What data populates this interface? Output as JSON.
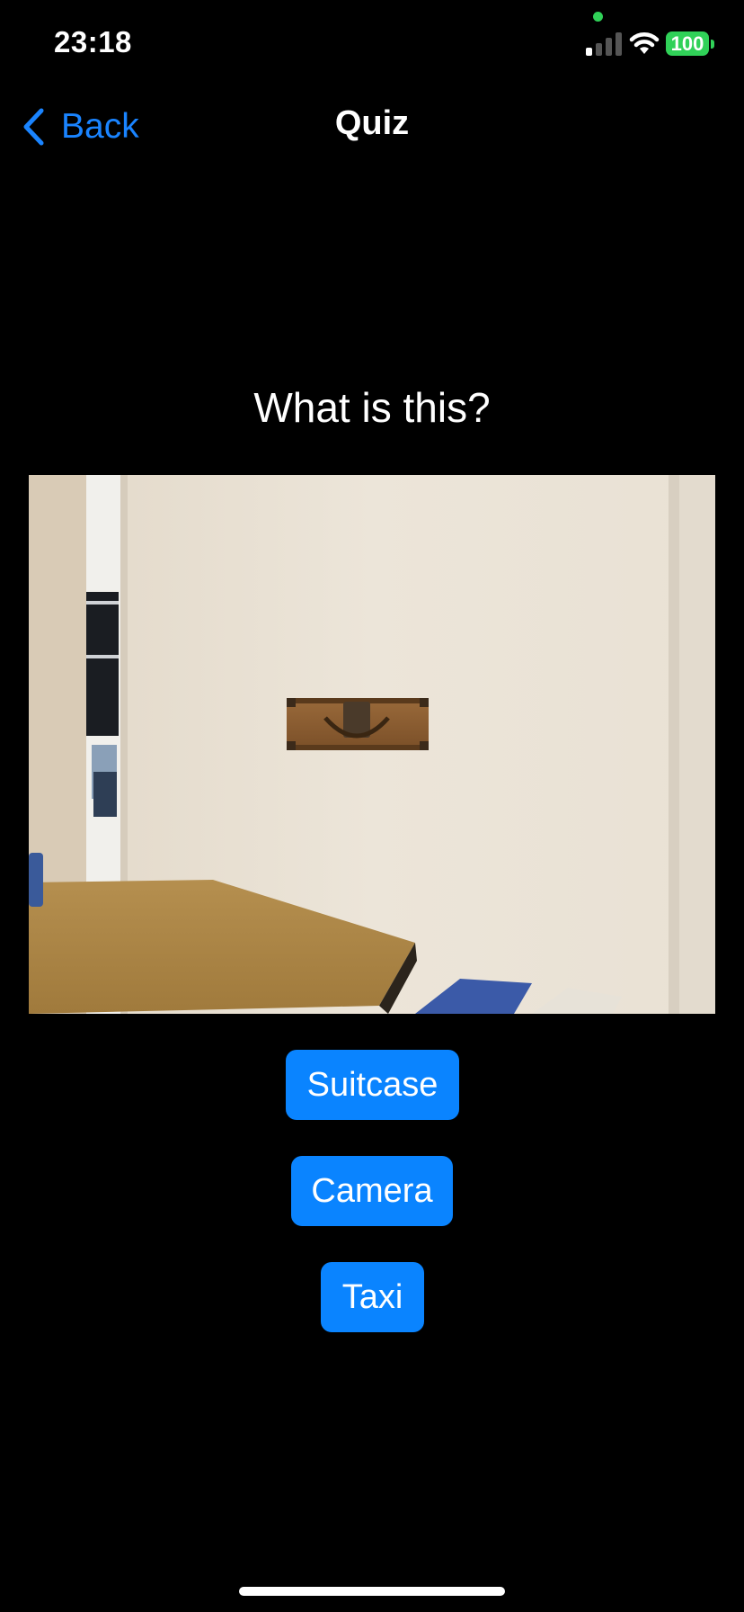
{
  "status_bar": {
    "time": "23:18",
    "battery": "100",
    "icons": [
      "camera-in-use-dot",
      "cellular-signal-icon",
      "wifi-icon",
      "battery-icon"
    ]
  },
  "nav": {
    "back_label": "Back",
    "title": "Quiz",
    "icon": "chevron-left-icon"
  },
  "quiz": {
    "question": "What is this?",
    "answers": [
      "Suitcase",
      "Camera",
      "Taxi"
    ]
  },
  "colors": {
    "background": "#000000",
    "accent": "#0a84ff",
    "link": "#1a84ff",
    "battery": "#30d158"
  }
}
